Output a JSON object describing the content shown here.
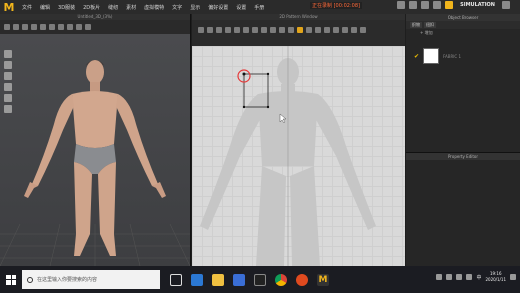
{
  "app": {
    "logo": "M",
    "menu": [
      "文件",
      "编辑",
      "3D服装",
      "2D板片",
      "缝纫",
      "素材",
      "虚拟模特",
      "文字",
      "显示",
      "偏好设置",
      "设置",
      "手册"
    ],
    "recording": "正在录制 [00:02:08]",
    "simulation_label": "SIMULATION"
  },
  "win3d": {
    "title": "Untitled_3D_(3%)"
  },
  "win2d": {
    "title": "2D Pattern Window"
  },
  "object_browser": {
    "title": "Object Browser",
    "tabs": [
      "织物",
      "纽扣"
    ],
    "add_label": "+ 增加",
    "fabric_name": "FABRIC 1"
  },
  "property_editor": {
    "title": "Property Editor"
  },
  "taskbar": {
    "search_placeholder": "在这里输入你要搜索的内容",
    "time": "19:16",
    "date": "2020/1/11",
    "lang": "中"
  },
  "colors": {
    "accent": "#f1b51c",
    "record": "#ff6a3a",
    "pattern_bg": "#d9d9d9"
  }
}
